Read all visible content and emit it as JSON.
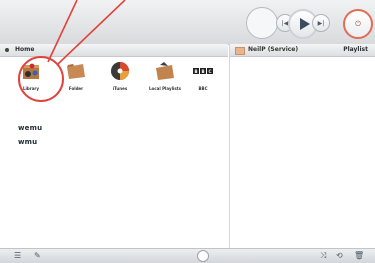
{
  "toolbar": {
    "prev_glyph": "|◀",
    "next_glyph": "▶|",
    "power_glyph": "⏻"
  },
  "left_panel": {
    "header": {
      "label": "Home"
    },
    "tiles": [
      {
        "label": "Library",
        "icon": "library-icon"
      },
      {
        "label": "Folder",
        "icon": "folder-icon"
      },
      {
        "label": "iTunes",
        "icon": "itunes-icon"
      },
      {
        "label": "Local Playlists",
        "icon": "local-playlists-icon"
      },
      {
        "label": "BBC",
        "icon": "bbc-icon"
      }
    ],
    "wemu_items": [
      "wemu",
      "wmu"
    ]
  },
  "right_panel": {
    "header": {
      "service": "NeilP (Service)",
      "playlist": "Playlist"
    }
  },
  "bottom_bar": {
    "list_glyph": "☰",
    "settings_glyph": "✎",
    "shuffle_glyph": "⤨",
    "repeat_glyph": "⟲",
    "trash_glyph": "🗑"
  },
  "colors": {
    "highlight_red": "#e0443d",
    "power_ring": "#e06d56",
    "play_triangle": "#3c4c5e"
  }
}
